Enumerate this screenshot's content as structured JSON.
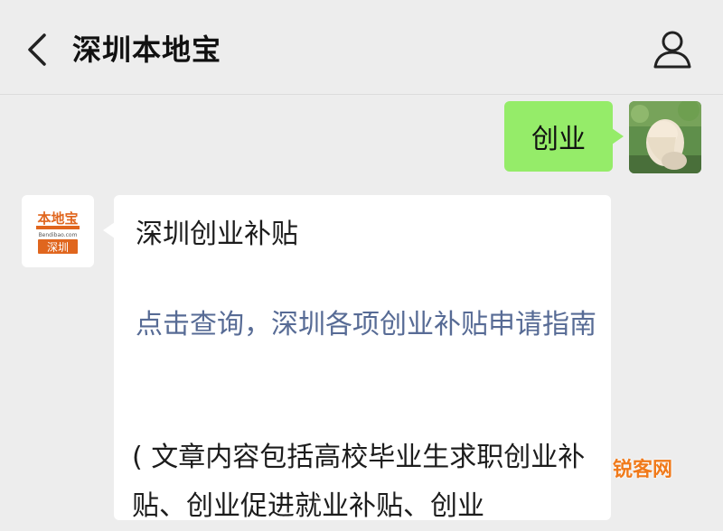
{
  "header": {
    "title": "深圳本地宝",
    "back_icon": "chevron-left-icon",
    "profile_icon": "person-icon"
  },
  "messages": {
    "outgoing": {
      "text": "创业"
    },
    "incoming": {
      "avatar_logo": {
        "top": "本地宝",
        "url": "Bendibao.com",
        "city": "深圳"
      },
      "title": "深圳创业补贴",
      "link_text": "点击查询，深圳各项创业补贴申请指南",
      "body_text": "( 文章内容包括高校毕业生求职创业补贴、创业促进就业补贴、创业"
    }
  },
  "watermark": {
    "text": "锐客网"
  },
  "colors": {
    "background": "#ededed",
    "outgoing_bubble": "#95ec69",
    "link": "#576b95",
    "logo_orange": "#e0661e"
  }
}
